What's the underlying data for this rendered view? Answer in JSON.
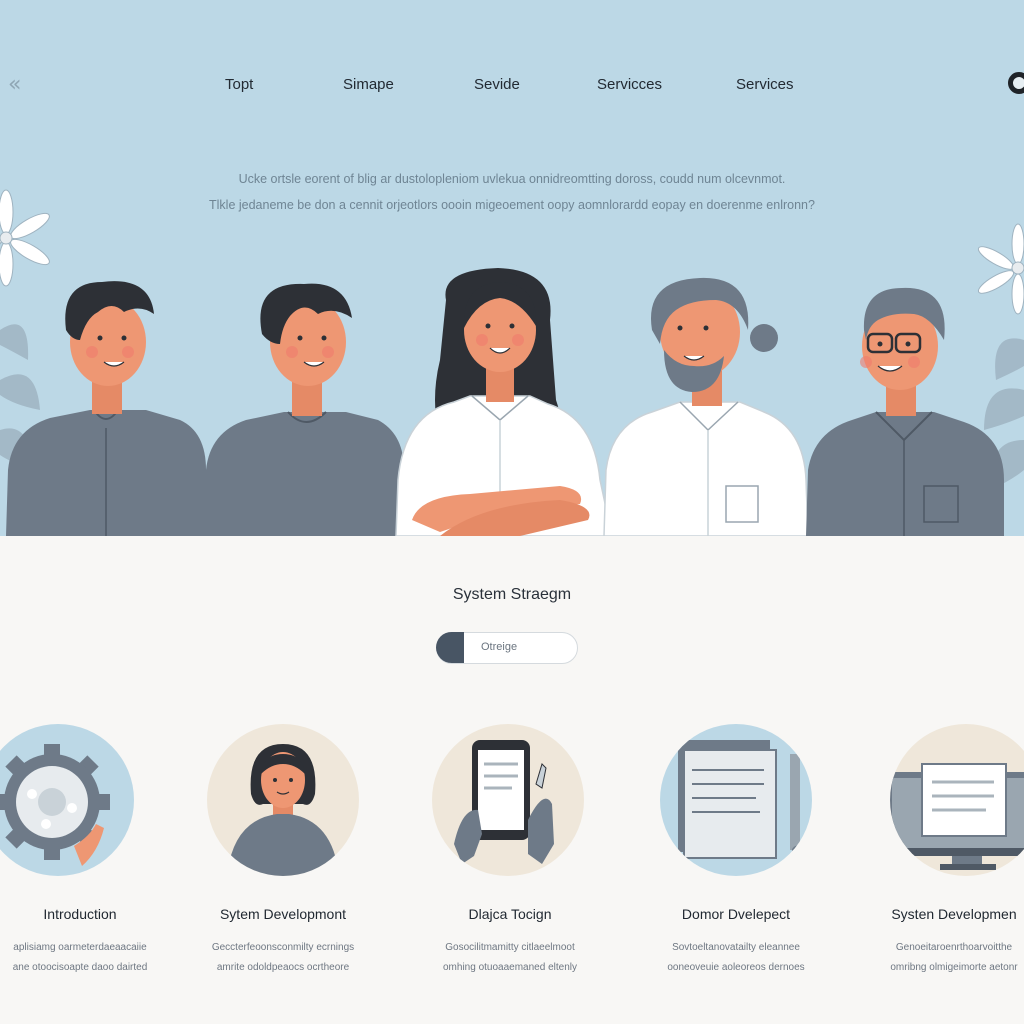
{
  "nav": {
    "items": [
      "Topt",
      "Simape",
      "Sevide",
      "Servicces",
      "Services"
    ]
  },
  "hero": {
    "line1": "Ucke ortsle eorent of blig ar dustolopleniom uvlekua onnidreomtting doross, coudd num olcevnmot.",
    "line2": "Tlkle jedaneme be don a cennit orjeotlors oooin migeoement oopy aomnlorardd eopay en doerenme enlronn?"
  },
  "section": {
    "title": "System Straegm",
    "toggle_label": "Otreige"
  },
  "cards": [
    {
      "title": "Introduction",
      "line1": "aplisiamg oarmeterdaeaacaiie",
      "line2": "ane otoocisoapte daoo dairted"
    },
    {
      "title": "Sytem Developmont",
      "line1": "Geccterfeoonsconmilty ecrnings",
      "line2": "amrite odoldpeaocs ocrtheore"
    },
    {
      "title": "Dlajca Tocign",
      "line1": "Gosocilitmamitty citlaeelmoot",
      "line2": "omhing otuoaaemaned eltenly"
    },
    {
      "title": "Domor Dvelepect",
      "line1": "Sovtoeltanovatailty eleannee",
      "line2": "ooneoveuie aoleoreos dernoes"
    },
    {
      "title": "Systen Developmen",
      "line1": "Genoeitaroenrthoarvoitthe",
      "line2": "omribng olmigeimorte aetonr"
    }
  ],
  "colors": {
    "hero_bg": "#bcd8e6",
    "page_bg": "#f8f7f5",
    "shirt_gray": "#6e7a88",
    "skin": "#ee9773",
    "hair_dark": "#2d3036",
    "toggle_knob": "#485564"
  }
}
